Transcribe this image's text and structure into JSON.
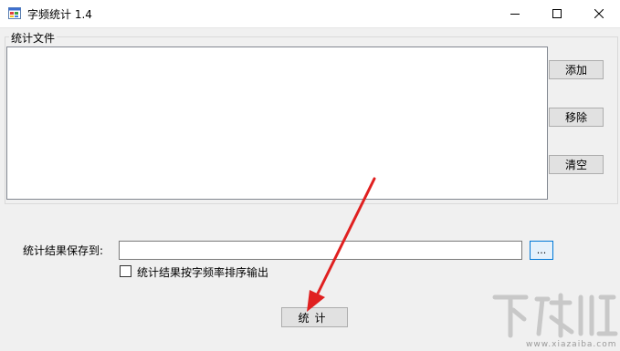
{
  "window": {
    "title": "字频统计 1.4",
    "min_icon": "minimize-icon",
    "max_icon": "maximize-icon",
    "close_icon": "close-icon"
  },
  "files_group": {
    "label": "统计文件",
    "files": [],
    "buttons": {
      "add": "添加",
      "remove": "移除",
      "clear": "清空"
    }
  },
  "output": {
    "save_label": "统计结果保存到:",
    "save_value": "",
    "browse_label": "...",
    "sort_checkbox_label": "统计结果按字频率排序输出",
    "sort_checked": false
  },
  "actions": {
    "run_label": "统计"
  },
  "annotation": {
    "arrow_color": "#e02020"
  },
  "watermark": {
    "logo": "下载吧",
    "url": "www.xiazaiba.com"
  }
}
